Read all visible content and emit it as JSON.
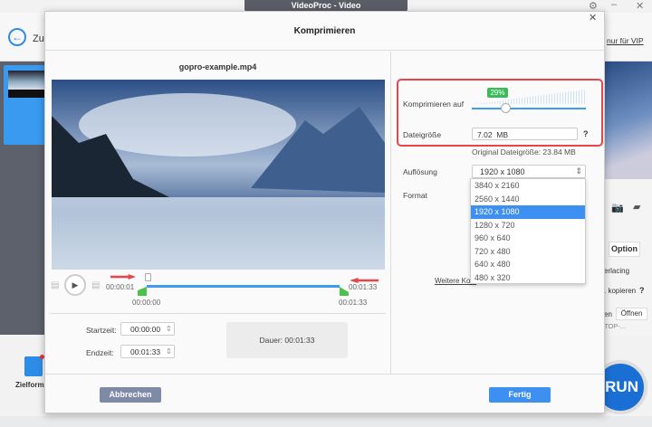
{
  "app": {
    "title": "VideoProc - Video",
    "back_label": "Zu",
    "vip_link": "nur für VIP",
    "option_label": "Option",
    "interlacing": "erlacing",
    "copy_label": ". kopieren",
    "help": "?",
    "open_label": "Öffnen",
    "open_prefix": "en",
    "path": "TOP-...",
    "target_format": "Zielform",
    "run_label": "RUN"
  },
  "dialog": {
    "title": "Komprimieren",
    "filename": "gopro-example.mp4",
    "timeline": {
      "current": "00:00:01",
      "end_top": "00:01:33",
      "start": "00:00:00",
      "end": "00:01:33",
      "playhead_fraction": 0.01
    },
    "startzeit_label": "Startzeit:",
    "startzeit": "00:00:00",
    "endzeit_label": "Endzeit:",
    "endzeit": "00:01:33",
    "dauer_label": "Dauer:",
    "dauer": "00:01:33",
    "compress_label": "Komprimieren auf",
    "compress_percent": "29%",
    "compress_value": 29,
    "filesize_label": "Dateigröße",
    "filesize": "7.02  MB",
    "filesize_help": "?",
    "original_size": "Original Dateigröße: 23.84 MB",
    "resolution_label": "Auflösung",
    "resolution": "1920 x 1080",
    "resolution_options": [
      "3840 x 2160",
      "2560 x 1440",
      "1920 x 1080",
      "1280 x 720",
      "960 x 640",
      "720 x 480",
      "640 x 480",
      "480 x 320"
    ],
    "format_label": "Format",
    "more_link": "Weitere Kom",
    "cancel": "Abbrechen",
    "done": "Fertig"
  },
  "colors": {
    "accent": "#3d8ff0",
    "highlight": "#e8454b",
    "green": "#4cc24c"
  }
}
